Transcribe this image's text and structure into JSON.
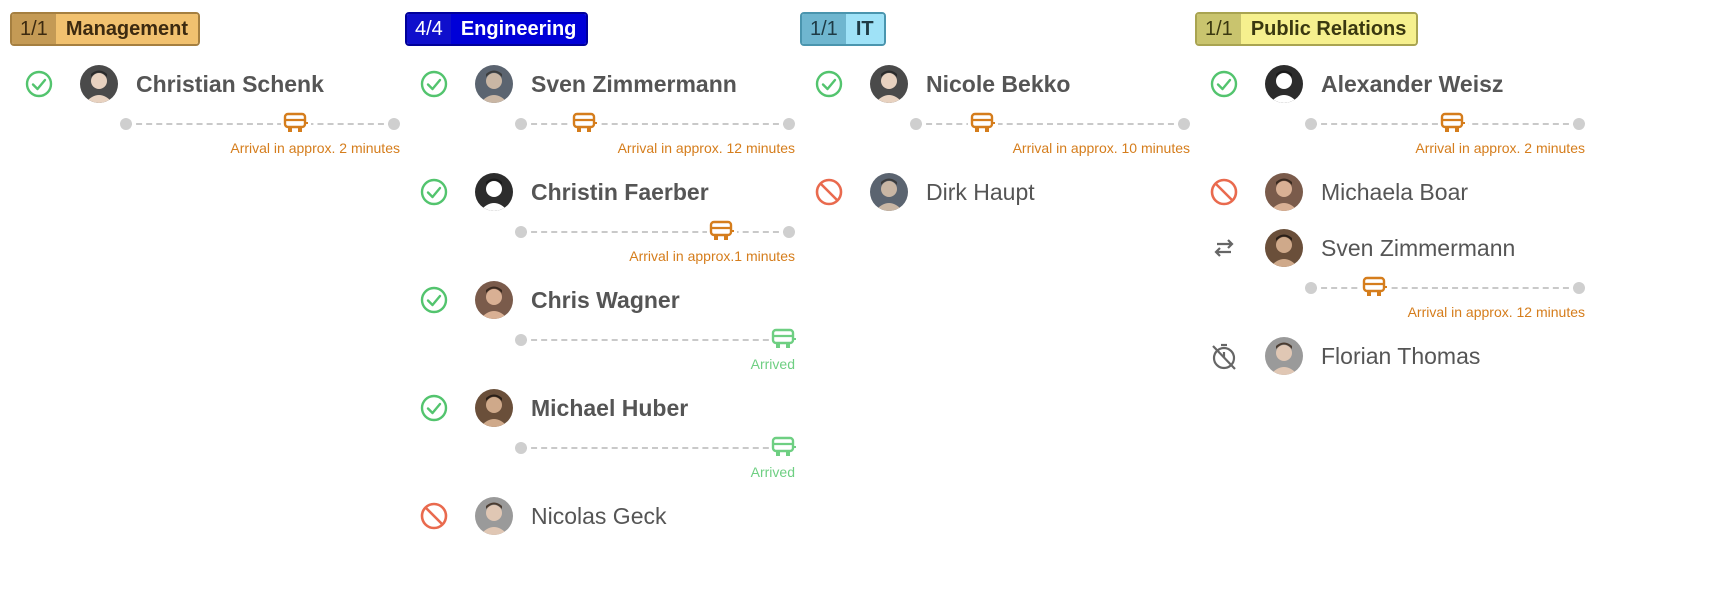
{
  "colors": {
    "check": "#53c46e",
    "blocked": "#e96a4e",
    "vehicle_pending": "#d57d1c",
    "vehicle_arrived": "#6ecf82",
    "icon_gray": "#666666"
  },
  "groups": [
    {
      "count": "1/1",
      "name": "Management",
      "badge_colors": {
        "count_bg": "#c49a55",
        "name_bg": "#f1c16f",
        "border": "#a57f40",
        "text": "#3c2a10"
      },
      "members": [
        {
          "name": "Christian Schenk",
          "status": "check-icon",
          "avatar": "avatar-person-icon",
          "eta": "Arrival in approx. 2 minutes",
          "eta_state": "pending",
          "progress": 0.63
        }
      ]
    },
    {
      "count": "4/4",
      "name": "Engineering",
      "badge_colors": {
        "count_bg": "#0f0fcc",
        "name_bg": "#0000d8",
        "border": "#00009a",
        "text": "#ffffff"
      },
      "members": [
        {
          "name": "Sven Zimmermann",
          "status": "check-icon",
          "avatar": "avatar-person-icon",
          "eta": "Arrival in approx. 12 minutes",
          "eta_state": "pending",
          "progress": 0.25
        },
        {
          "name": "Christin Faerber",
          "status": "check-icon",
          "avatar": "avatar-cat-icon",
          "eta": "Arrival in approx.1 minutes",
          "eta_state": "pending",
          "progress": 0.74
        },
        {
          "name": "Chris Wagner",
          "status": "check-icon",
          "avatar": "avatar-person-icon",
          "eta": "Arrived",
          "eta_state": "arrived",
          "progress": 0.96
        },
        {
          "name": "Michael Huber",
          "status": "check-icon",
          "avatar": "avatar-person-icon",
          "eta": "Arrived",
          "eta_state": "arrived",
          "progress": 0.96
        },
        {
          "name": "Nicolas Geck",
          "status": "blocked-icon",
          "avatar": "avatar-person-icon"
        }
      ]
    },
    {
      "count": "1/1",
      "name": "IT",
      "badge_colors": {
        "count_bg": "#6fb6cf",
        "name_bg": "#9fe2f7",
        "border": "#4a95ae",
        "text": "#1e3b45"
      },
      "members": [
        {
          "name": "Nicole Bekko",
          "status": "check-icon",
          "avatar": "avatar-person-icon",
          "eta": "Arrival in approx. 10 minutes",
          "eta_state": "pending",
          "progress": 0.26
        },
        {
          "name": "Dirk Haupt",
          "status": "blocked-icon",
          "avatar": "avatar-person-icon"
        }
      ]
    },
    {
      "count": "1/1",
      "name": "Public Relations",
      "badge_colors": {
        "count_bg": "#c9c46e",
        "name_bg": "#f6f08e",
        "border": "#a9a451",
        "text": "#3a3810"
      },
      "members": [
        {
          "name": "Alexander Weisz",
          "status": "check-icon",
          "avatar": "avatar-person-icon",
          "eta": "Arrival in approx. 2 minutes",
          "eta_state": "pending",
          "progress": 0.53
        },
        {
          "name": "Michaela Boar",
          "status": "blocked-icon",
          "avatar": "avatar-person-icon"
        },
        {
          "name": "Sven Zimmermann",
          "status": "swap-icon",
          "avatar": "avatar-person-icon",
          "eta": "Arrival in approx. 12 minutes",
          "eta_state": "pending",
          "progress": 0.25
        },
        {
          "name": "Florian Thomas",
          "status": "timer-off-icon",
          "avatar": "avatar-person-icon"
        }
      ]
    }
  ]
}
